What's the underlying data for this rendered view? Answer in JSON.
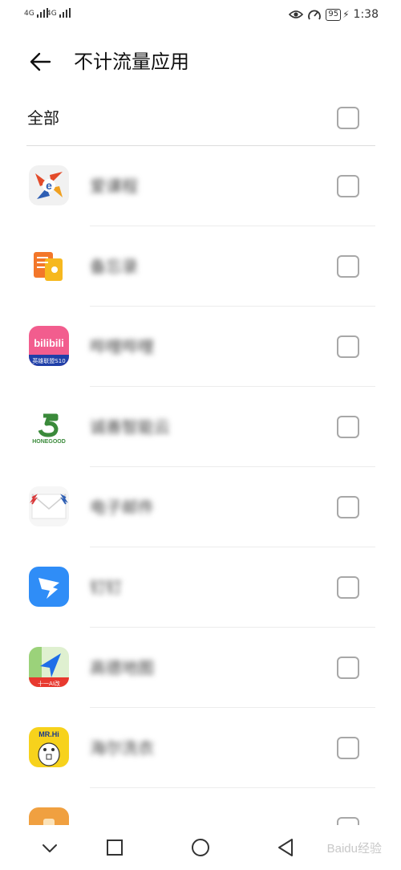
{
  "status_bar": {
    "signal_1": "4G",
    "signal_2": "4G",
    "signal_2_sub": "1x",
    "battery": "95",
    "time": "1:38"
  },
  "header": {
    "title": "不计流量应用"
  },
  "select_all": {
    "label": "全部",
    "checked": false
  },
  "apps": [
    {
      "name": "爱课程",
      "icon": "icourse-icon",
      "checked": false
    },
    {
      "name": "备忘录",
      "icon": "notes-icon",
      "checked": false
    },
    {
      "name": "哔哩哔哩",
      "icon": "bilibili-icon",
      "checked": false
    },
    {
      "name": "诚善智能云",
      "icon": "honegood-icon",
      "checked": false
    },
    {
      "name": "电子邮件",
      "icon": "email-icon",
      "checked": false
    },
    {
      "name": "钉钉",
      "icon": "dingtalk-icon",
      "checked": false
    },
    {
      "name": "高德地图",
      "icon": "amap-icon",
      "checked": false
    },
    {
      "name": "海尔洗衣",
      "icon": "haier-laundry-icon",
      "checked": false
    },
    {
      "name": "",
      "icon": "app-icon",
      "checked": false
    }
  ],
  "icon_text": {
    "bilibili": "bilibili",
    "bilibili_sub": "英雄联盟S10",
    "honegood": "HONEGOOD",
    "amap": "十一AI改",
    "haier": "MR.Hi"
  },
  "nav_bar": [
    "chevron-down-icon",
    "square-icon",
    "circle-home-icon",
    "triangle-back-icon"
  ],
  "watermark": "Baidu经验",
  "colors": {
    "checkbox_border": "#a8a8a8",
    "divider": "#dcdcdc"
  }
}
